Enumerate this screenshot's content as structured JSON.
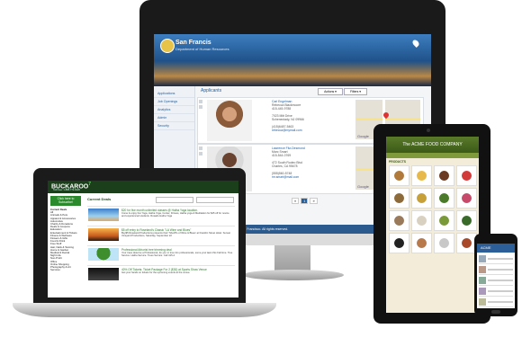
{
  "imac": {
    "app": {
      "title": "San Francis",
      "subtitle": "Department of Human Resources",
      "nav": [
        "Applications",
        "Job Openings",
        "Analytics",
        "Admin",
        "Security"
      ],
      "section_title": "Applicants",
      "actions_button": "Actions ▾",
      "filters_button": "Filters ▾",
      "applicant1": {
        "name": "Carl Engelman",
        "lines": [
          "Rebecca Blackmoore",
          "415-445-9788",
          "",
          "7023 Mitt Drive",
          "Schenectady, NJ 09966",
          "",
          "(415)6487-5463",
          "rebecca@mymail.com"
        ]
      },
      "applicant2": {
        "name": "Lawrence Fitz-Desmond",
        "lines": [
          "Marc Smart",
          "415-544-0769",
          "",
          "472 South Rodeo Blvd",
          "Charles, CA 95678",
          "",
          "(555)560-5748",
          "mr.smart@mail.com"
        ]
      },
      "pagination": [
        "«",
        "1",
        "»"
      ],
      "map_label": "Google",
      "footer": "San Francisco. All rights reserved."
    }
  },
  "laptop": {
    "brand": "BUCKAROO",
    "brand_suffix": "7",
    "tagline": "Toll Free: 1-888-772-6226",
    "subscribe": "Click here to Subscribe!",
    "current_deals": "Current Deals",
    "categories_title": "Current Deals",
    "categories": [
      "All",
      "Animals & Pets",
      "Apparel & Accessories",
      "Automotive",
      "Charity & Donations",
      "Deals & Coupons",
      "Education",
      "Entertainment & Tickets",
      "Fitness & Wellness",
      "Flowers & Gifts",
      "Food & Drink",
      "Free Stuff",
      "Hair, Nails & Tanning",
      "Home & Garden",
      "Medical & Dental",
      "Night Life",
      "Non-Profit",
      "Office",
      "Online Shopping",
      "Photography & Art",
      "Services"
    ],
    "deals": [
      {
        "title": "$20 for five month unlimited classes @ Hatha Yoga location.",
        "text": "Come & enjoy five Yoga, Hatha Yoga, Center, Fitness, Hatha yoga & Meditation for $45 off for novice and experienced students. Rosado Hatha Yoga"
      },
      {
        "title": "$5 off entry to Roseland's Classic \"LA Wine and Blues\"",
        "text": "Buy$5 Roseland Productions presents their 'Sheriff's of Wine & Blues' at Franklin Street Hotel. Sunset Vineyard Productions, Saturday, September 22"
      },
      {
        "title": "Professional Arborist tree trimming deal",
        "text": "Your trees deserve a Professional, do you 'a' tree trim professionals, some your lawn this Fall time. Tree Service. Hatha Service. Trees Service. Call 415-4"
      },
      {
        "title": "40% Off Tickets: Ticket Package For 2 ($30) at Sports Show Venue",
        "text": "Get your hands on tickets for the upcoming events at the venue."
      }
    ]
  },
  "tablet": {
    "title": "The ACME FOOD COMPANY",
    "products_label": "PRODUCTS"
  },
  "phone": {
    "title": "ACME"
  }
}
